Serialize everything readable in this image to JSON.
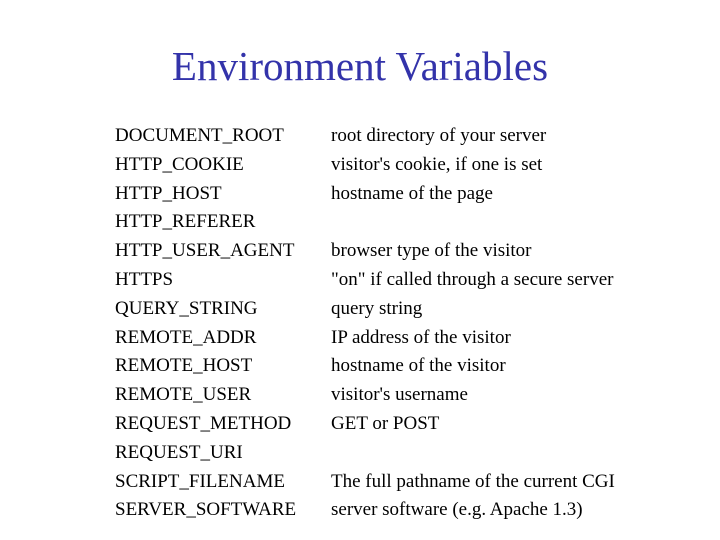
{
  "slide": {
    "title": "Environment Variables",
    "title_color": "#3333aa"
  },
  "variables": [
    {
      "name": "DOCUMENT_ROOT",
      "description": "root directory of your server"
    },
    {
      "name": "HTTP_COOKIE",
      "description": "visitor's cookie, if one is set"
    },
    {
      "name": "HTTP_HOST",
      "description": "hostname of the page"
    },
    {
      "name": "HTTP_REFERER",
      "description": ""
    },
    {
      "name": "HTTP_USER_AGENT",
      "description": "browser type of the visitor"
    },
    {
      "name": "HTTPS",
      "description": "\"on\" if called through a secure server"
    },
    {
      "name": "QUERY_STRING",
      "description": "query string"
    },
    {
      "name": "REMOTE_ADDR",
      "description": "IP address of the visitor"
    },
    {
      "name": "REMOTE_HOST",
      "description": "hostname of the visitor"
    },
    {
      "name": "REMOTE_USER",
      "description": "visitor's username"
    },
    {
      "name": "REQUEST_METHOD",
      "description": "GET or POST"
    },
    {
      "name": "REQUEST_URI",
      "description": ""
    },
    {
      "name": "SCRIPT_FILENAME",
      "description": "The full pathname of the current CGI"
    },
    {
      "name": "SERVER_SOFTWARE",
      "description": "server software (e.g. Apache 1.3)"
    }
  ]
}
